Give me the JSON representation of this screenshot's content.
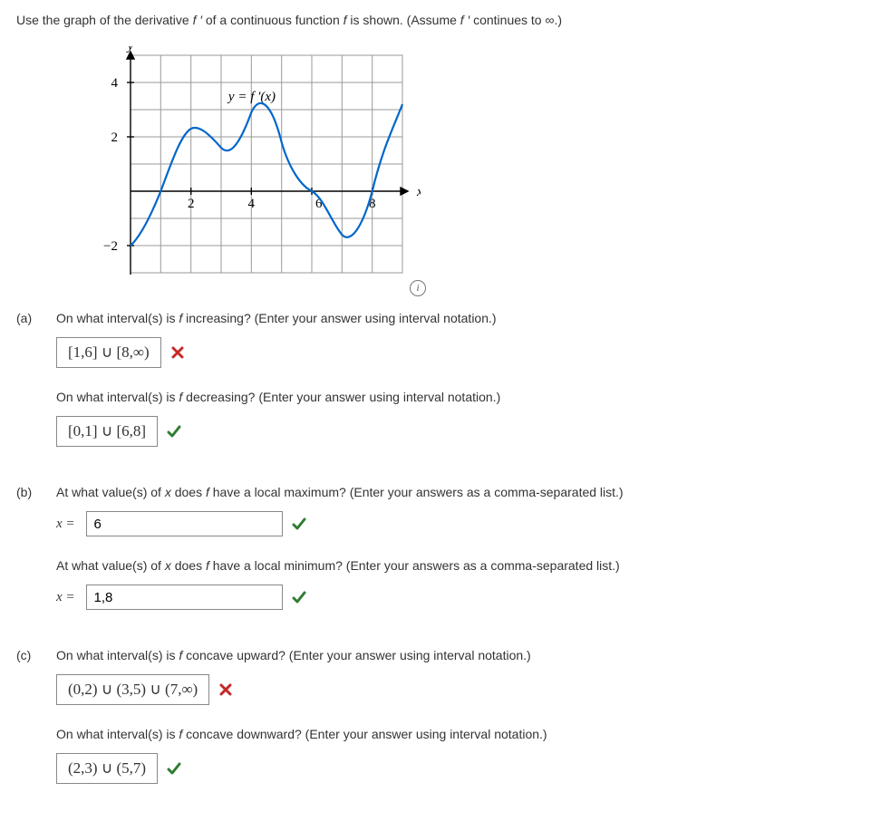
{
  "prompt_a": "Use the graph of the derivative ",
  "prompt_b": " of a continuous function ",
  "prompt_c": " is shown. (Assume ",
  "prompt_d": " continues to ∞.)",
  "fprime": "f ′",
  "fletter": "f",
  "graph": {
    "ylabel": "y",
    "xlabel": "x",
    "curve_label": "y = f ′(x)",
    "yticks": [
      "4",
      "2",
      "−2"
    ],
    "xticks": [
      "2",
      "4",
      "6",
      "8"
    ]
  },
  "parts": {
    "a": {
      "label": "(a)",
      "q1_a": "On what interval(s) is ",
      "q1_b": " increasing? (Enter your answer using interval notation.)",
      "ans1": "[1,6] ∪ [8,∞)",
      "mark1": "wrong",
      "q2_a": "On what interval(s) is ",
      "q2_b": " decreasing? (Enter your answer using interval notation.)",
      "ans2": "[0,1] ∪ [6,8]",
      "mark2": "correct"
    },
    "b": {
      "label": "(b)",
      "q1_a": "At what value(s) of ",
      "q1_b": " does ",
      "q1_c": " have a local maximum? (Enter your answers as a comma-separated list.)",
      "xeq": "x =",
      "ans1": "6",
      "mark1": "correct",
      "q2_a": "At what value(s) of ",
      "q2_b": " does ",
      "q2_c": " have a local minimum? (Enter your answers as a comma-separated list.)",
      "ans2": "1,8",
      "mark2": "correct"
    },
    "c": {
      "label": "(c)",
      "q1_a": "On what interval(s) is ",
      "q1_b": " concave upward? (Enter your answer using interval notation.)",
      "ans1": "(0,2) ∪ (3,5) ∪ (7,∞)",
      "mark1": "wrong",
      "q2_a": "On what interval(s) is ",
      "q2_b": " concave downward? (Enter your answer using interval notation.)",
      "ans2": "(2,3) ∪ (5,7)",
      "mark2": "correct"
    }
  },
  "xvar": "x",
  "chart_data": {
    "type": "line",
    "title": "",
    "xlabel": "x",
    "ylabel": "y",
    "xlim": [
      0,
      9
    ],
    "ylim": [
      -3,
      5
    ],
    "series": [
      {
        "name": "y = f'(x)",
        "x": [
          0.0,
          0.5,
          1.0,
          1.5,
          2.0,
          2.5,
          3.0,
          3.5,
          4.0,
          4.5,
          5.0,
          5.5,
          6.0,
          6.5,
          7.0,
          7.5,
          8.0,
          8.5,
          9.0
        ],
        "values": [
          -2.0,
          -1.2,
          0.0,
          1.3,
          2.3,
          2.0,
          1.6,
          2.0,
          2.9,
          2.6,
          1.8,
          0.9,
          0.0,
          -1.2,
          -1.6,
          -0.9,
          0.0,
          1.5,
          3.2
        ]
      }
    ],
    "xticks": [
      2,
      4,
      6,
      8
    ],
    "yticks": [
      -2,
      2,
      4
    ],
    "grid": true
  }
}
